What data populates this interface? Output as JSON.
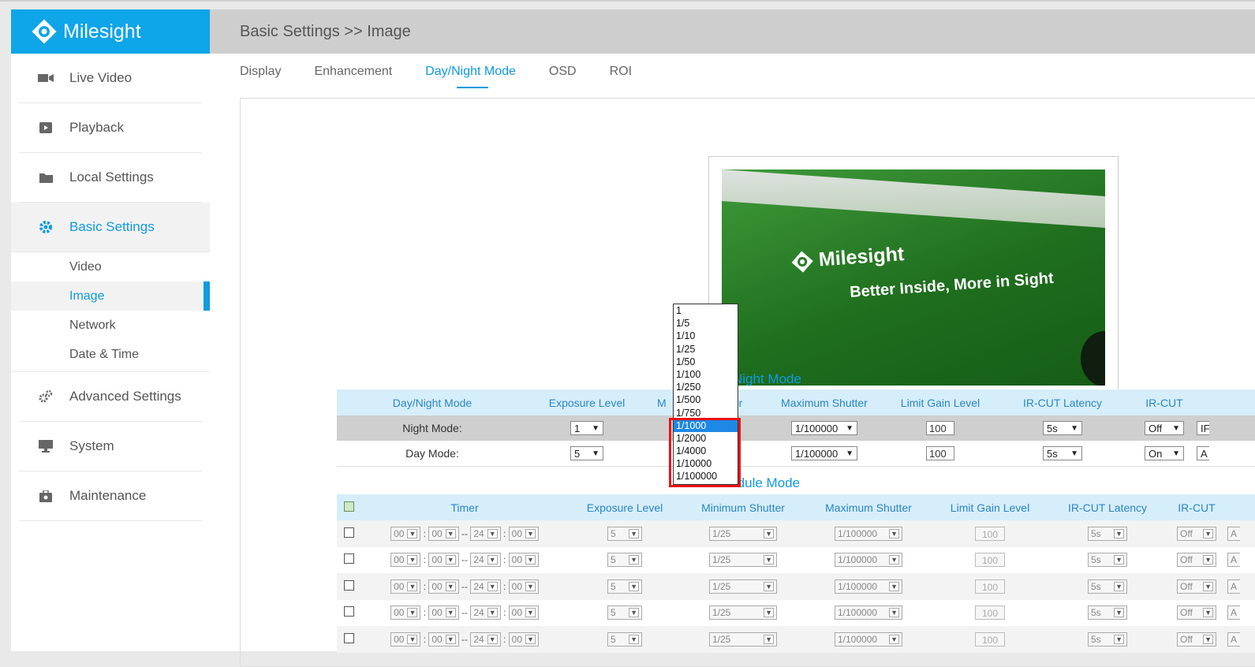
{
  "brand": {
    "name": "Milesight"
  },
  "sidebar": {
    "items": [
      {
        "label": "Live Video",
        "icon": "camera-icon"
      },
      {
        "label": "Playback",
        "icon": "playback-icon"
      },
      {
        "label": "Local Settings",
        "icon": "folder-icon"
      },
      {
        "label": "Basic Settings",
        "icon": "gear-icon"
      },
      {
        "label": "Advanced Settings",
        "icon": "gears-icon"
      },
      {
        "label": "System",
        "icon": "monitor-icon"
      },
      {
        "label": "Maintenance",
        "icon": "toolbox-icon"
      }
    ],
    "subitems": [
      "Video",
      "Image",
      "Network",
      "Date & Time"
    ]
  },
  "header": {
    "breadcrumb": "Basic Settings >> Image"
  },
  "tabs": [
    "Display",
    "Enhancement",
    "Day/Night Mode",
    "OSD",
    "ROI"
  ],
  "preview": {
    "brand": "Milesight",
    "slogan": "Better Inside, More in Sight"
  },
  "daynight": {
    "title": "Day/Night Mode",
    "headers": [
      "Day/Night Mode",
      "Exposure Level",
      "M",
      "er",
      "Maximum Shutter",
      "Limit Gain Level",
      "IR-CUT Latency",
      "IR-CUT",
      ""
    ],
    "rows": [
      {
        "label": "Night Mode:",
        "exposure": "1",
        "max_shutter": "1/100000",
        "gain": "100",
        "latency": "5s",
        "ircut": "Off",
        "extra": "IF"
      },
      {
        "label": "Day Mode:",
        "exposure": "5",
        "max_shutter": "1/100000",
        "gain": "100",
        "latency": "5s",
        "ircut": "On",
        "extra": "A"
      }
    ]
  },
  "schedule": {
    "title": "Schedule Mode",
    "headers": [
      "Timer",
      "Exposure Level",
      "Minimum Shutter",
      "Maximum Shutter",
      "Limit Gain Level",
      "IR-CUT Latency",
      "IR-CUT"
    ],
    "row": {
      "h1": "00",
      "m1": "00",
      "sep": "--",
      "h2": "24",
      "m2": "00",
      "exposure": "5",
      "min_shutter": "1/25",
      "max_shutter": "1/100000",
      "gain": "100",
      "latency": "5s",
      "ircut": "Off",
      "extra": "A"
    }
  },
  "dropdown": {
    "options": [
      "1",
      "1/5",
      "1/10",
      "1/25",
      "1/50",
      "1/100",
      "1/250",
      "1/500",
      "1/750",
      "1/1000",
      "1/2000",
      "1/4000",
      "1/10000",
      "1/100000"
    ],
    "selected": "1/1000"
  },
  "colors": {
    "accent": "#0e9be0",
    "highlight_box": "#e11111"
  }
}
